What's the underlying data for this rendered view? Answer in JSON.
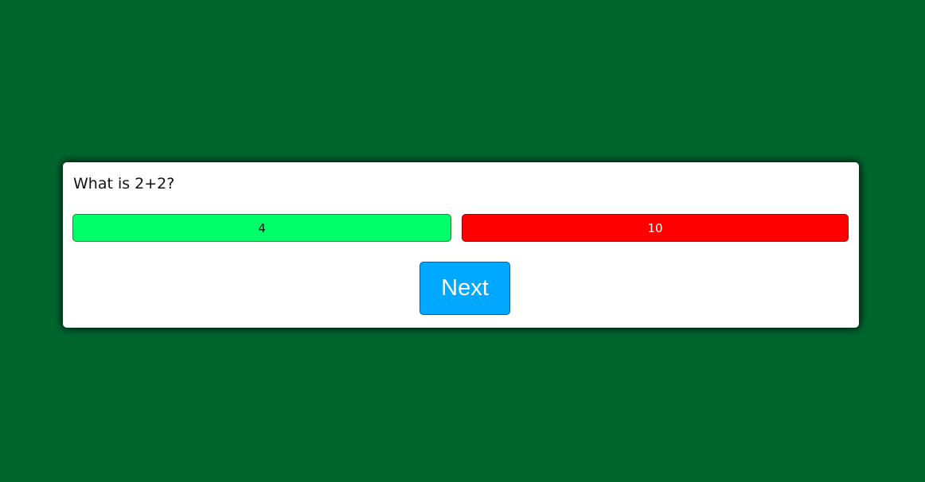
{
  "quiz": {
    "question": "What is 2+2?",
    "answers": [
      {
        "label": "4",
        "state": "correct",
        "color": "#00ff6a"
      },
      {
        "label": "10",
        "state": "wrong",
        "color": "#ff0000"
      }
    ],
    "next_label": "Next"
  },
  "theme": {
    "background": "#00662e",
    "card_background": "#ffffff",
    "next_button_color": "#00a8ff"
  }
}
